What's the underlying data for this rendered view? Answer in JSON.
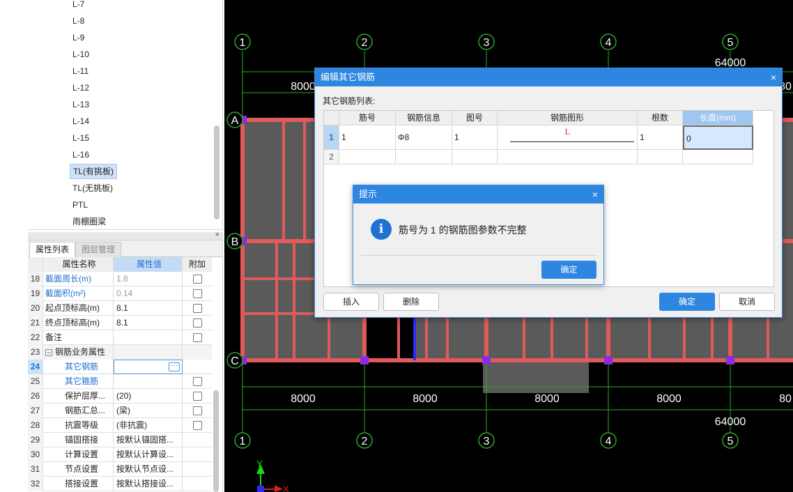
{
  "tree": {
    "items": [
      "L-7",
      "L-8",
      "L-9",
      "L-10",
      "L-11",
      "L-12",
      "L-13",
      "L-14",
      "L-15",
      "L-16",
      "TL(有挑板)",
      "TL(无挑板)",
      "PTL",
      "雨棚圈梁"
    ],
    "selected_index": 10
  },
  "prop_panel": {
    "tabs": [
      "属性列表",
      "图层管理"
    ],
    "close_glyph": "×",
    "headers": {
      "name": "属性名称",
      "value": "属性值",
      "extra": "附加"
    },
    "rows": [
      {
        "num": "18",
        "name": "截面周长(m)",
        "value": "1.8",
        "style": "blue",
        "value_style": "gray",
        "checkbox": true
      },
      {
        "num": "19",
        "name": "截面积(m²)",
        "value": "0.14",
        "style": "blue",
        "value_style": "gray",
        "checkbox": true
      },
      {
        "num": "20",
        "name": "起点顶标高(m)",
        "value": "8.1",
        "style": "",
        "value_style": "",
        "checkbox": true
      },
      {
        "num": "21",
        "name": "终点顶标高(m)",
        "value": "8.1",
        "style": "",
        "value_style": "",
        "checkbox": true
      },
      {
        "num": "22",
        "name": "备注",
        "value": "",
        "style": "",
        "value_style": "",
        "checkbox": true
      },
      {
        "num": "23",
        "name": "钢筋业务属性",
        "value": "",
        "style": "group",
        "value_style": "",
        "checkbox": false
      },
      {
        "num": "24",
        "name": "其它钢筋",
        "value": "",
        "style": "blue-indent",
        "value_style": "",
        "checkbox": false,
        "selected": true
      },
      {
        "num": "25",
        "name": "其它箍筋",
        "value": "",
        "style": "blue-indent",
        "value_style": "",
        "checkbox": true
      },
      {
        "num": "26",
        "name": "保护层厚...",
        "value": "(20)",
        "style": "indent",
        "value_style": "",
        "checkbox": true
      },
      {
        "num": "27",
        "name": "钢筋汇总...",
        "value": "(梁)",
        "style": "indent",
        "value_style": "",
        "checkbox": true
      },
      {
        "num": "28",
        "name": "抗震等级",
        "value": "(非抗震)",
        "style": "indent",
        "value_style": "",
        "checkbox": true
      },
      {
        "num": "29",
        "name": "锚固搭接",
        "value": "按默认锚固搭...",
        "style": "indent",
        "value_style": "",
        "checkbox": false
      },
      {
        "num": "30",
        "name": "计算设置",
        "value": "按默认计算设...",
        "style": "indent",
        "value_style": "",
        "checkbox": false
      },
      {
        "num": "31",
        "name": "节点设置",
        "value": "按默认节点设...",
        "style": "indent",
        "value_style": "",
        "checkbox": false
      },
      {
        "num": "32",
        "name": "搭接设置",
        "value": "按默认搭接设...",
        "style": "indent",
        "value_style": "",
        "checkbox": false
      }
    ]
  },
  "cad": {
    "axis_numbers": [
      "1",
      "2",
      "3",
      "4",
      "5"
    ],
    "axis_letters": [
      "A",
      "B",
      "C"
    ],
    "spacing_labels": [
      "8000",
      "8000",
      "8000",
      "8000",
      "80"
    ],
    "total_label": "64000",
    "top_partial": [
      "8000",
      "80"
    ],
    "coord_x": "X",
    "coord_y": "Y"
  },
  "dialog": {
    "title": "编辑其它钢筋",
    "close": "×",
    "list_label": "其它钢筋列表:",
    "columns": [
      "筋号",
      "钢筋信息",
      "图号",
      "钢筋图形",
      "根数",
      "长度(mm)"
    ],
    "rows": [
      {
        "num": "1",
        "bar_no": "1",
        "info": "Φ8",
        "fig_no": "1",
        "shape_label": "L",
        "count": "1",
        "length": "0"
      },
      {
        "num": "2",
        "bar_no": "",
        "info": "",
        "fig_no": "",
        "shape_label": "",
        "count": "",
        "length": ""
      }
    ],
    "buttons": {
      "insert": "插入",
      "delete": "删除",
      "ok": "确定",
      "cancel": "取消"
    }
  },
  "alert": {
    "title": "提示",
    "close": "×",
    "icon_glyph": "i",
    "message": "筋号为 1 的钢筋图参数不完整",
    "ok": "确定"
  }
}
